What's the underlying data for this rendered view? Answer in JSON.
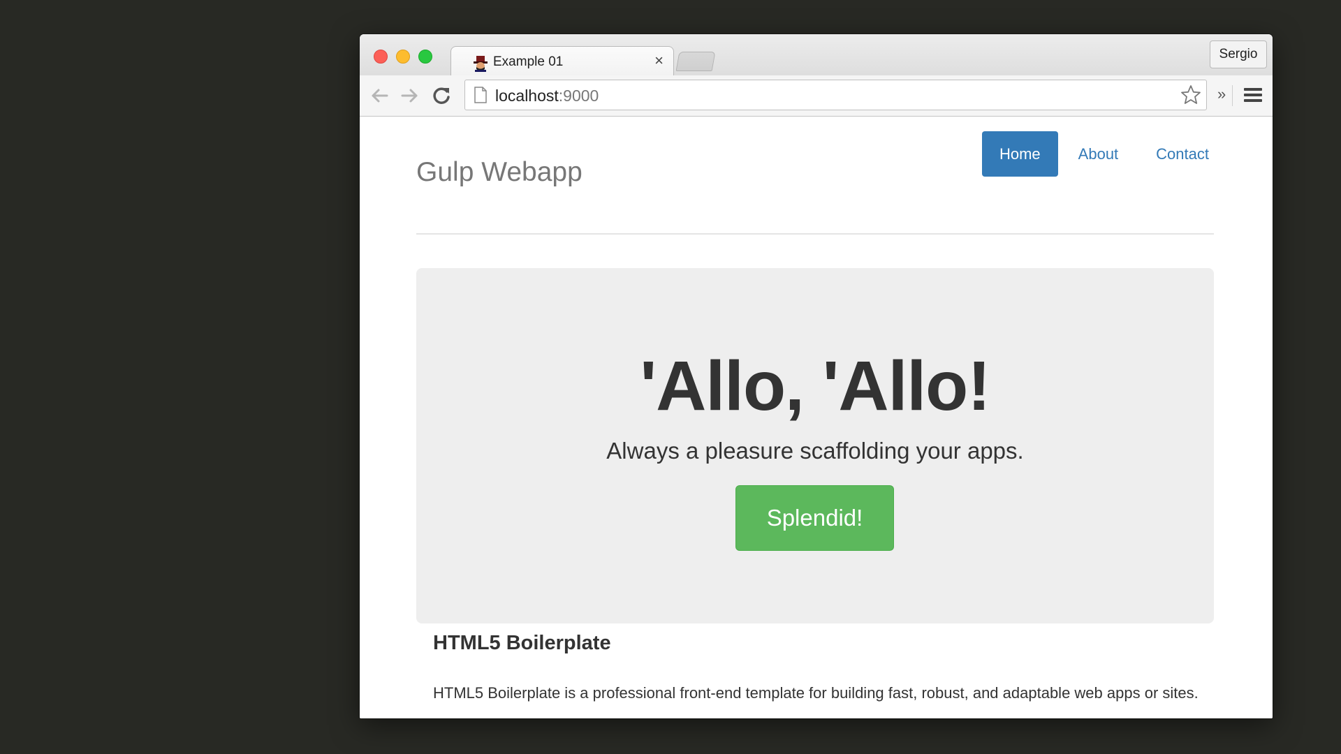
{
  "browser": {
    "tab_title": "Example 01",
    "tab_close": "×",
    "profile_name": "Sergio",
    "url_host": "localhost",
    "url_port": ":9000",
    "extensions_chevron": "»"
  },
  "site": {
    "brand": "Gulp Webapp",
    "nav": [
      {
        "label": "Home",
        "active": true
      },
      {
        "label": "About",
        "active": false
      },
      {
        "label": "Contact",
        "active": false
      }
    ],
    "jumbotron": {
      "heading": "'Allo, 'Allo!",
      "lead": "Always a pleasure scaffolding your apps.",
      "button": "Splendid!"
    },
    "marketing": {
      "heading": "HTML5 Boilerplate",
      "text": "HTML5 Boilerplate is a professional front-end template for building fast, robust, and adaptable web apps or sites."
    }
  },
  "colors": {
    "desktop_bg": "#282924",
    "primary": "#337ab7",
    "success": "#5cb85c",
    "jumbotron_bg": "#eeeeee"
  },
  "icons": [
    "back-arrow-icon",
    "forward-arrow-icon",
    "reload-icon",
    "page-icon",
    "star-icon",
    "menu-icon",
    "close-icon",
    "favicon-icon"
  ]
}
